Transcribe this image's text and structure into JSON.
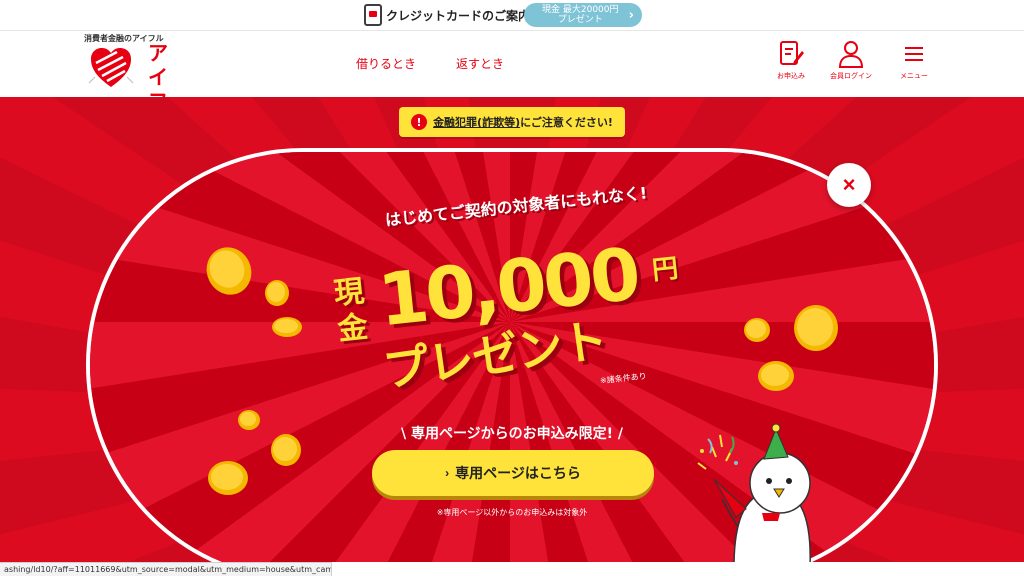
{
  "topbar": {
    "card_link_label": "クレジットカードのご案内",
    "cash_pill_line1": "現金 最大20000円",
    "cash_pill_line2": "プレゼント",
    "cash_pill_chevron": "›"
  },
  "header": {
    "tagline": "消費者金融のアイフル",
    "logo_text": "アイフル",
    "nav": [
      {
        "label": "借りるとき"
      },
      {
        "label": "返すとき"
      }
    ],
    "apply_label": "お申込み",
    "login_label": "会員ログイン",
    "menu_label": "メニュー"
  },
  "alert": {
    "icon": "!",
    "link_text": "金融犯罪(詐欺等)",
    "rest_text": "にご注意ください!"
  },
  "modal": {
    "close_icon": "×",
    "lead": "はじめてご契約の対象者にもれなく!",
    "kanji": "現金",
    "amount": "10,000",
    "yen": "円",
    "present": "プレゼント",
    "conditions": "※諸条件あり",
    "limited": "\\ 専用ページからのお申込み限定! /",
    "cta_chevron": "›",
    "cta_label": "専用ページはこちら",
    "footnote": "※専用ページ以外からのお申込みは対象外"
  },
  "statusbar": {
    "url": "ashing/ld10/?aff=11011669&utm_source=modal&utm_medium=house&utm_campaign=CP_A"
  },
  "colors": {
    "brand_red": "#e60012",
    "hero_red": "#dc0b20",
    "gold": "#ffe23a",
    "pill_blue": "#7fc3d7"
  }
}
